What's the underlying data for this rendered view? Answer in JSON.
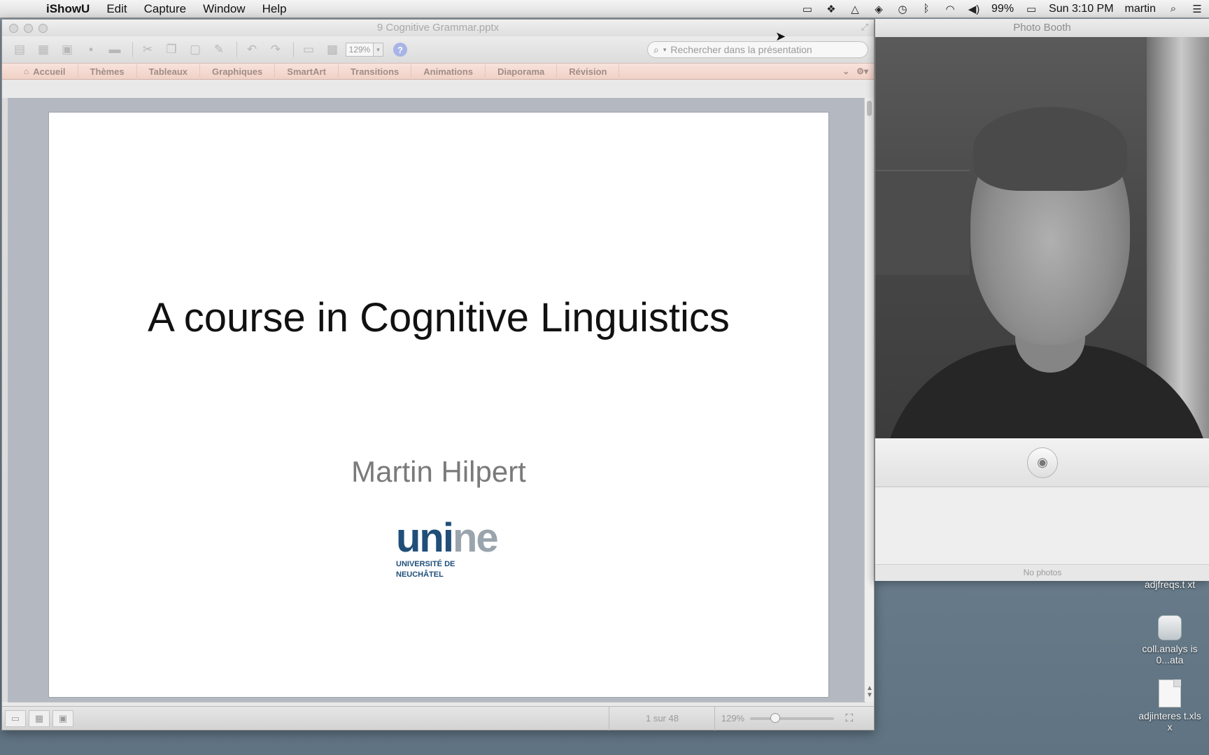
{
  "menubar": {
    "app_name": "iShowU",
    "items": [
      "Edit",
      "Capture",
      "Window",
      "Help"
    ],
    "status_icons": [
      "screen-recording-icon",
      "dropbox-icon",
      "google-drive-icon",
      "security-icon",
      "time-machine-icon",
      "bluetooth-icon",
      "wifi-icon",
      "volume-icon"
    ],
    "battery": "99%",
    "clock": "Sun 3:10 PM",
    "user": "martin"
  },
  "powerpoint": {
    "window_title": "9 Cognitive Grammar.pptx",
    "zoom_value": "129%",
    "search_placeholder": "Rechercher dans la présentation",
    "ribbon_tabs": [
      "Accueil",
      "Thèmes",
      "Tableaux",
      "Graphiques",
      "SmartArt",
      "Transitions",
      "Animations",
      "Diaporama",
      "Révision"
    ],
    "slide": {
      "title": "A course in Cognitive Linguistics",
      "subtitle": "Martin Hilpert",
      "logo_text_dark": "uni",
      "logo_text_light": "ne",
      "logo_caption_1": "UNIVERSITÉ DE",
      "logo_caption_2": "NEUCHÂTEL"
    },
    "status": {
      "page_indicator": "1 sur 48",
      "zoom_label": "129%",
      "zoom_level_fraction": 0.3
    }
  },
  "photobooth": {
    "window_title": "Photo Booth",
    "footer": "No photos"
  },
  "desktop": {
    "items": [
      "adjfreqs.txt",
      "coll.analysis.rdata",
      "adjinteres t.xlsx"
    ],
    "item_1_display": "adjfreqs.t xt",
    "item_2_display": "coll.analys is0...ata",
    "item_3_display": "adjinteres t.xlsx"
  }
}
